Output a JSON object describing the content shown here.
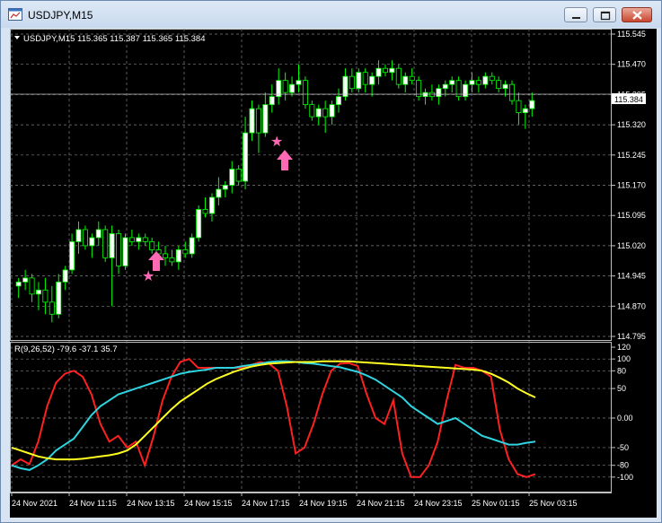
{
  "window": {
    "title": "USDJPY,M15"
  },
  "chart_data": [
    {
      "type": "candlestick",
      "header": "USDJPY,M15  115.365 115.387 115.365 115.384",
      "y_ticks": [
        "115.545",
        "115.470",
        "115.395",
        "115.320",
        "115.245",
        "115.170",
        "115.095",
        "115.020",
        "114.945",
        "114.870",
        "114.795"
      ],
      "ylim": [
        114.795,
        115.545
      ],
      "current_price": "115.384",
      "grid": true,
      "bull_color": "#ffffff",
      "bear_color": "#00ff00",
      "wick_color": "#00ff00",
      "arrow_color": "#ff69b4",
      "candles": [
        [
          114.92,
          114.94,
          114.89,
          114.93
        ],
        [
          114.93,
          114.96,
          114.91,
          114.94
        ],
        [
          114.94,
          114.95,
          114.88,
          114.9
        ],
        [
          114.9,
          114.93,
          114.86,
          114.91
        ],
        [
          114.91,
          114.94,
          114.85,
          114.88
        ],
        [
          114.88,
          114.92,
          114.83,
          114.85
        ],
        [
          114.85,
          114.95,
          114.84,
          114.93
        ],
        [
          114.93,
          114.97,
          114.91,
          114.96
        ],
        [
          114.96,
          115.05,
          114.95,
          115.03
        ],
        [
          115.03,
          115.08,
          115.0,
          115.06
        ],
        [
          115.06,
          115.07,
          115.01,
          115.02
        ],
        [
          115.02,
          115.05,
          114.99,
          115.04
        ],
        [
          115.04,
          115.08,
          115.02,
          115.06
        ],
        [
          115.06,
          115.07,
          114.98,
          114.99
        ],
        [
          114.99,
          115.07,
          114.87,
          115.05
        ],
        [
          115.05,
          115.06,
          114.95,
          114.97
        ],
        [
          114.97,
          115.05,
          114.96,
          115.04
        ],
        [
          115.04,
          115.06,
          115.02,
          115.03
        ],
        [
          115.03,
          115.05,
          115.01,
          115.04
        ],
        [
          115.04,
          115.05,
          115.02,
          115.03
        ],
        [
          115.03,
          115.04,
          115.0,
          115.01
        ],
        [
          115.01,
          115.03,
          114.99,
          115.0
        ],
        [
          115.0,
          115.02,
          114.97,
          114.99
        ],
        [
          114.99,
          115.01,
          114.97,
          114.98
        ],
        [
          114.98,
          115.02,
          114.96,
          115.01
        ],
        [
          115.01,
          115.03,
          114.99,
          115.0
        ],
        [
          115.0,
          115.05,
          114.99,
          115.04
        ],
        [
          115.04,
          115.12,
          115.03,
          115.11
        ],
        [
          115.11,
          115.14,
          115.09,
          115.1
        ],
        [
          115.1,
          115.15,
          115.08,
          115.14
        ],
        [
          115.14,
          115.19,
          115.12,
          115.16
        ],
        [
          115.16,
          115.18,
          115.14,
          115.17
        ],
        [
          115.17,
          115.23,
          115.15,
          115.21
        ],
        [
          115.21,
          115.22,
          115.17,
          115.18
        ],
        [
          115.18,
          115.34,
          115.16,
          115.3
        ],
        [
          115.3,
          115.38,
          115.28,
          115.36
        ],
        [
          115.36,
          115.37,
          115.25,
          115.3
        ],
        [
          115.3,
          115.4,
          115.29,
          115.37
        ],
        [
          115.37,
          115.42,
          115.35,
          115.39
        ],
        [
          115.39,
          115.46,
          115.37,
          115.43
        ],
        [
          115.43,
          115.45,
          115.38,
          115.4
        ],
        [
          115.4,
          115.44,
          115.39,
          115.42
        ],
        [
          115.42,
          115.47,
          115.4,
          115.43
        ],
        [
          115.43,
          115.44,
          115.36,
          115.37
        ],
        [
          115.37,
          115.38,
          115.33,
          115.34
        ],
        [
          115.34,
          115.37,
          115.32,
          115.36
        ],
        [
          115.36,
          115.38,
          115.3,
          115.34
        ],
        [
          115.34,
          115.38,
          115.32,
          115.37
        ],
        [
          115.37,
          115.41,
          115.35,
          115.39
        ],
        [
          115.39,
          115.46,
          115.38,
          115.44
        ],
        [
          115.44,
          115.46,
          115.4,
          115.41
        ],
        [
          115.41,
          115.46,
          115.4,
          115.45
        ],
        [
          115.45,
          115.46,
          115.4,
          115.42
        ],
        [
          115.42,
          115.45,
          115.39,
          115.44
        ],
        [
          115.44,
          115.48,
          115.42,
          115.46
        ],
        [
          115.46,
          115.47,
          115.44,
          115.45
        ],
        [
          115.45,
          115.48,
          115.43,
          115.46
        ],
        [
          115.46,
          115.47,
          115.41,
          115.42
        ],
        [
          115.42,
          115.45,
          115.4,
          115.44
        ],
        [
          115.44,
          115.46,
          115.42,
          115.43
        ],
        [
          115.43,
          115.44,
          115.38,
          115.39
        ],
        [
          115.39,
          115.41,
          115.37,
          115.4
        ],
        [
          115.4,
          115.42,
          115.38,
          115.39
        ],
        [
          115.39,
          115.42,
          115.37,
          115.41
        ],
        [
          115.41,
          115.43,
          115.39,
          115.42
        ],
        [
          115.42,
          115.44,
          115.4,
          115.43
        ],
        [
          115.43,
          115.44,
          115.38,
          115.39
        ],
        [
          115.39,
          115.43,
          115.38,
          115.42
        ],
        [
          115.42,
          115.45,
          115.4,
          115.43
        ],
        [
          115.43,
          115.44,
          115.4,
          115.42
        ],
        [
          115.42,
          115.45,
          115.41,
          115.44
        ],
        [
          115.44,
          115.45,
          115.42,
          115.43
        ],
        [
          115.43,
          115.44,
          115.4,
          115.41
        ],
        [
          115.41,
          115.43,
          115.39,
          115.42
        ],
        [
          115.42,
          115.43,
          115.37,
          115.38
        ],
        [
          115.38,
          115.4,
          115.32,
          115.35
        ],
        [
          115.35,
          115.37,
          115.31,
          115.36
        ],
        [
          115.36,
          115.4,
          115.34,
          115.38
        ]
      ]
    },
    {
      "type": "line",
      "label": "R(9,26,52) -79.6 -37.1 35.7",
      "y_ticks": [
        "120",
        "100",
        "80",
        "50",
        "0.00",
        "-50",
        "-80",
        "-100"
      ],
      "ylim": [
        -120,
        120
      ],
      "series": [
        {
          "color": "#ff2020",
          "values": [
            -80,
            -70,
            -78,
            -40,
            20,
            60,
            75,
            80,
            70,
            40,
            -10,
            -40,
            -30,
            -50,
            -40,
            -80,
            -30,
            30,
            70,
            95,
            100,
            85,
            85,
            85,
            85,
            85,
            85,
            90,
            95,
            92,
            80,
            20,
            -60,
            -50,
            -10,
            40,
            80,
            92,
            93,
            88,
            40,
            0,
            -10,
            30,
            -60,
            -100,
            -100,
            -80,
            -40,
            30,
            90,
            85,
            85,
            80,
            70,
            -20,
            -70,
            -95,
            -100,
            -95
          ]
        },
        {
          "color": "#2fd4e0",
          "values": [
            -80,
            -85,
            -88,
            -80,
            -70,
            -55,
            -45,
            -35,
            -15,
            5,
            20,
            30,
            40,
            45,
            50,
            55,
            60,
            65,
            70,
            75,
            78,
            80,
            82,
            85,
            85,
            85,
            88,
            90,
            92,
            95,
            96,
            96,
            95,
            93,
            92,
            90,
            88,
            86,
            82,
            78,
            72,
            65,
            55,
            45,
            35,
            20,
            10,
            0,
            -10,
            -5,
            0,
            -10,
            -20,
            -30,
            -35,
            -40,
            -45,
            -45,
            -42,
            -40
          ]
        },
        {
          "color": "#ffff20",
          "values": [
            -50,
            -55,
            -60,
            -65,
            -68,
            -70,
            -70,
            -70,
            -69,
            -67,
            -65,
            -63,
            -60,
            -55,
            -45,
            -30,
            -15,
            0,
            15,
            28,
            38,
            48,
            58,
            66,
            72,
            78,
            83,
            87,
            90,
            92,
            93,
            94,
            95,
            95,
            95,
            96,
            96,
            96,
            96,
            95,
            94,
            93,
            92,
            91,
            90,
            89,
            88,
            87,
            86,
            85,
            84,
            83,
            82,
            80,
            75,
            68,
            60,
            50,
            42,
            35
          ]
        }
      ]
    }
  ],
  "x_ticks": [
    "24 Nov 2021",
    "24 Nov 11:15",
    "24 Nov 13:15",
    "24 Nov 15:15",
    "24 Nov 17:15",
    "24 Nov 19:15",
    "24 Nov 21:15",
    "24 Nov 23:15",
    "25 Nov 01:15",
    "25 Nov 03:15"
  ]
}
